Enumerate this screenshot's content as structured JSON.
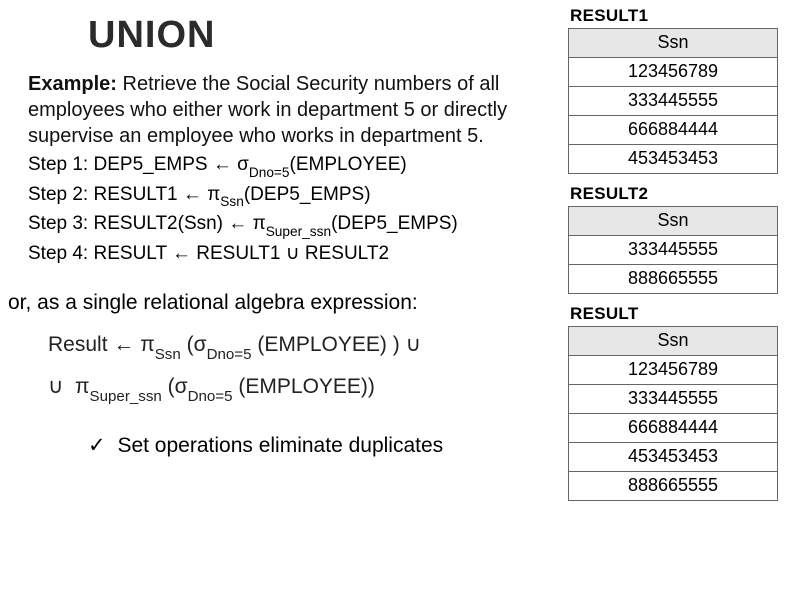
{
  "title": "UNION",
  "example": {
    "label": "Example:",
    "text": "Retrieve the Social Security numbers of all employees who either work in department 5 or directly supervise an employee who works in department 5."
  },
  "steps": [
    {
      "label": "Step 1:",
      "expr": {
        "lhs": "DEP5_EMPS",
        "op": "σ",
        "sub": "Dno=5",
        "arg": "(EMPLOYEE)"
      }
    },
    {
      "label": "Step 2:",
      "expr": {
        "lhs": "RESULT1",
        "op": "π",
        "sub": "Ssn",
        "arg": "(DEP5_EMPS)"
      }
    },
    {
      "label": "Step 3:",
      "expr": {
        "lhs": "RESULT2(Ssn)",
        "op": "π",
        "sub": "Super_ssn",
        "arg": "(DEP5_EMPS)"
      }
    },
    {
      "label": "Step 4:",
      "expr_union": {
        "lhs": "RESULT",
        "a": "RESULT1",
        "b": "RESULT2"
      }
    }
  ],
  "or_line": "or, as a single relational algebra expression:",
  "combined": {
    "lhs": "Result",
    "p1_op": "π",
    "p1_sub": "Ssn",
    "s1_op": "σ",
    "s1_sub": "Dno=5",
    "s1_arg": "(EMPLOYEE) )",
    "p2_op": "π",
    "p2_sub": "Super_ssn",
    "s2_op": "σ",
    "s2_sub": "Dno=5",
    "s2_arg": "(EMPLOYEE))"
  },
  "note": "Set operations eliminate duplicates",
  "symbols": {
    "assign": "←",
    "union": "∪",
    "check": "✓",
    "lparen": "(",
    "rparen": ")"
  },
  "results": [
    {
      "title": "RESULT1",
      "header": "Ssn",
      "rows": [
        "123456789",
        "333445555",
        "666884444",
        "453453453"
      ]
    },
    {
      "title": "RESULT2",
      "header": "Ssn",
      "rows": [
        "333445555",
        "888665555"
      ]
    },
    {
      "title": "RESULT",
      "header": "Ssn",
      "rows": [
        "123456789",
        "333445555",
        "666884444",
        "453453453",
        "888665555"
      ]
    }
  ],
  "chart_data": {
    "type": "table",
    "tables": [
      {
        "name": "RESULT1",
        "columns": [
          "Ssn"
        ],
        "rows": [
          [
            "123456789"
          ],
          [
            "333445555"
          ],
          [
            "666884444"
          ],
          [
            "453453453"
          ]
        ]
      },
      {
        "name": "RESULT2",
        "columns": [
          "Ssn"
        ],
        "rows": [
          [
            "333445555"
          ],
          [
            "888665555"
          ]
        ]
      },
      {
        "name": "RESULT",
        "columns": [
          "Ssn"
        ],
        "rows": [
          [
            "123456789"
          ],
          [
            "333445555"
          ],
          [
            "666884444"
          ],
          [
            "453453453"
          ],
          [
            "888665555"
          ]
        ]
      }
    ]
  }
}
